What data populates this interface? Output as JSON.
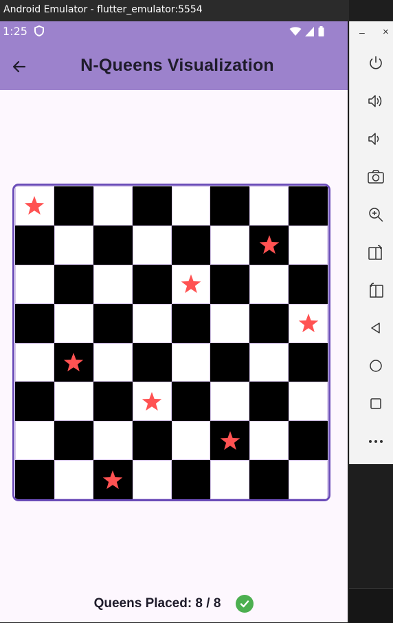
{
  "window": {
    "title": "Android Emulator - flutter_emulator:5554"
  },
  "statusbar": {
    "time": "1:25"
  },
  "appbar": {
    "title": "N-Queens Visualization"
  },
  "board": {
    "size": 8,
    "queens": [
      [
        0,
        0
      ],
      [
        1,
        6
      ],
      [
        2,
        4
      ],
      [
        3,
        7
      ],
      [
        4,
        1
      ],
      [
        5,
        3
      ],
      [
        6,
        5
      ],
      [
        7,
        2
      ]
    ],
    "colors": {
      "light": "#ffffff",
      "dark": "#000000",
      "queen": "#ff5252",
      "border": "#6a4cb8"
    }
  },
  "footer": {
    "queens_placed": "Queens Placed: 8 / 8"
  },
  "sidepanel": {
    "minimize": "–",
    "close": "×",
    "icons": [
      "power-icon",
      "volume-up-icon",
      "volume-down-icon",
      "camera-icon",
      "zoom-in-icon",
      "rotate-left-icon",
      "rotate-right-icon",
      "back-icon",
      "home-icon",
      "overview-icon",
      "more-icon"
    ]
  }
}
